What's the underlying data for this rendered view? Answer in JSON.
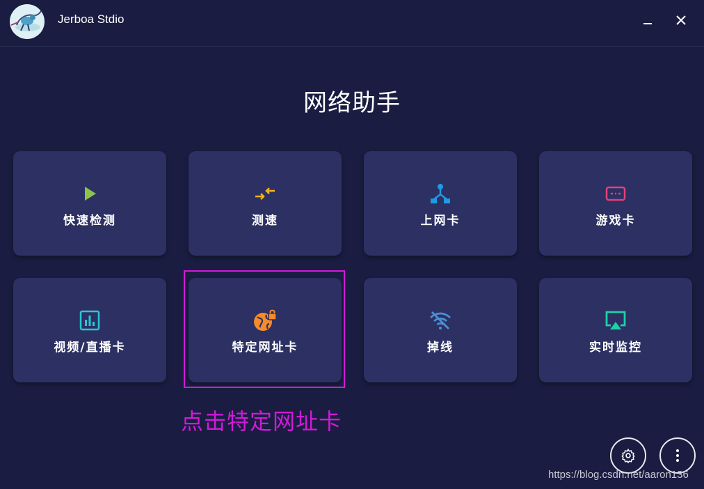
{
  "window": {
    "app_title": "Jerboa Stdio",
    "minimize_icon": "minimize-icon",
    "close_icon": "close-icon"
  },
  "page": {
    "title": "网络助手"
  },
  "cards": [
    {
      "label": "快速检测",
      "icon": "play-icon",
      "color": "#8bc34a"
    },
    {
      "label": "测速",
      "icon": "swap-arrows-icon",
      "color": "#f2b51b"
    },
    {
      "label": "上网卡",
      "icon": "network-tree-icon",
      "color": "#1e9be6"
    },
    {
      "label": "游戏卡",
      "icon": "gamepad-icon",
      "color": "#e0427a"
    },
    {
      "label": "视频/直播卡",
      "icon": "bar-chart-icon",
      "color": "#29c6d6"
    },
    {
      "label": "特定网址卡",
      "icon": "globe-lock-icon",
      "color": "#f58b2d"
    },
    {
      "label": "掉线",
      "icon": "wifi-off-icon",
      "color": "#4a8fd6"
    },
    {
      "label": "实时监控",
      "icon": "airplay-icon",
      "color": "#1fd0a7"
    }
  ],
  "annotation": {
    "text": "点击特定网址卡",
    "color": "#d01ad9"
  },
  "footer": {
    "settings_icon": "gear-icon",
    "more_icon": "more-vertical-icon",
    "watermark": "https://blog.csdn.net/aaron136"
  }
}
